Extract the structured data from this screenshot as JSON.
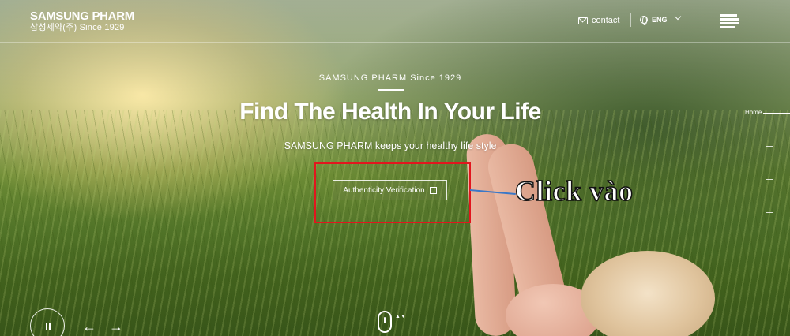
{
  "header": {
    "logo_main": "SAMSUNG PHARM",
    "logo_sub": "삼성제약(주) Since 1929",
    "contact_label": "contact",
    "lang_label": "ENG",
    "icons": [
      "envelope-icon",
      "globe-icon",
      "chevron-down-icon",
      "hamburger-menu-icon"
    ]
  },
  "hero": {
    "eyebrow": "SAMSUNG PHARM Since 1929",
    "headline": "Find The Health In Your Life",
    "subline": "SAMSUNG PHARM keeps your healthy life style",
    "button_label": "Authenticity Verification"
  },
  "annotation": {
    "text": "Click vào",
    "box_color": "#e2161e",
    "line_color": "#3a78c8"
  },
  "pager": {
    "home_label": "Home",
    "slide_count": 4
  },
  "controls": {
    "prev_arrow": "←",
    "next_arrow": "→",
    "scroll_arrows": "▲▼"
  }
}
